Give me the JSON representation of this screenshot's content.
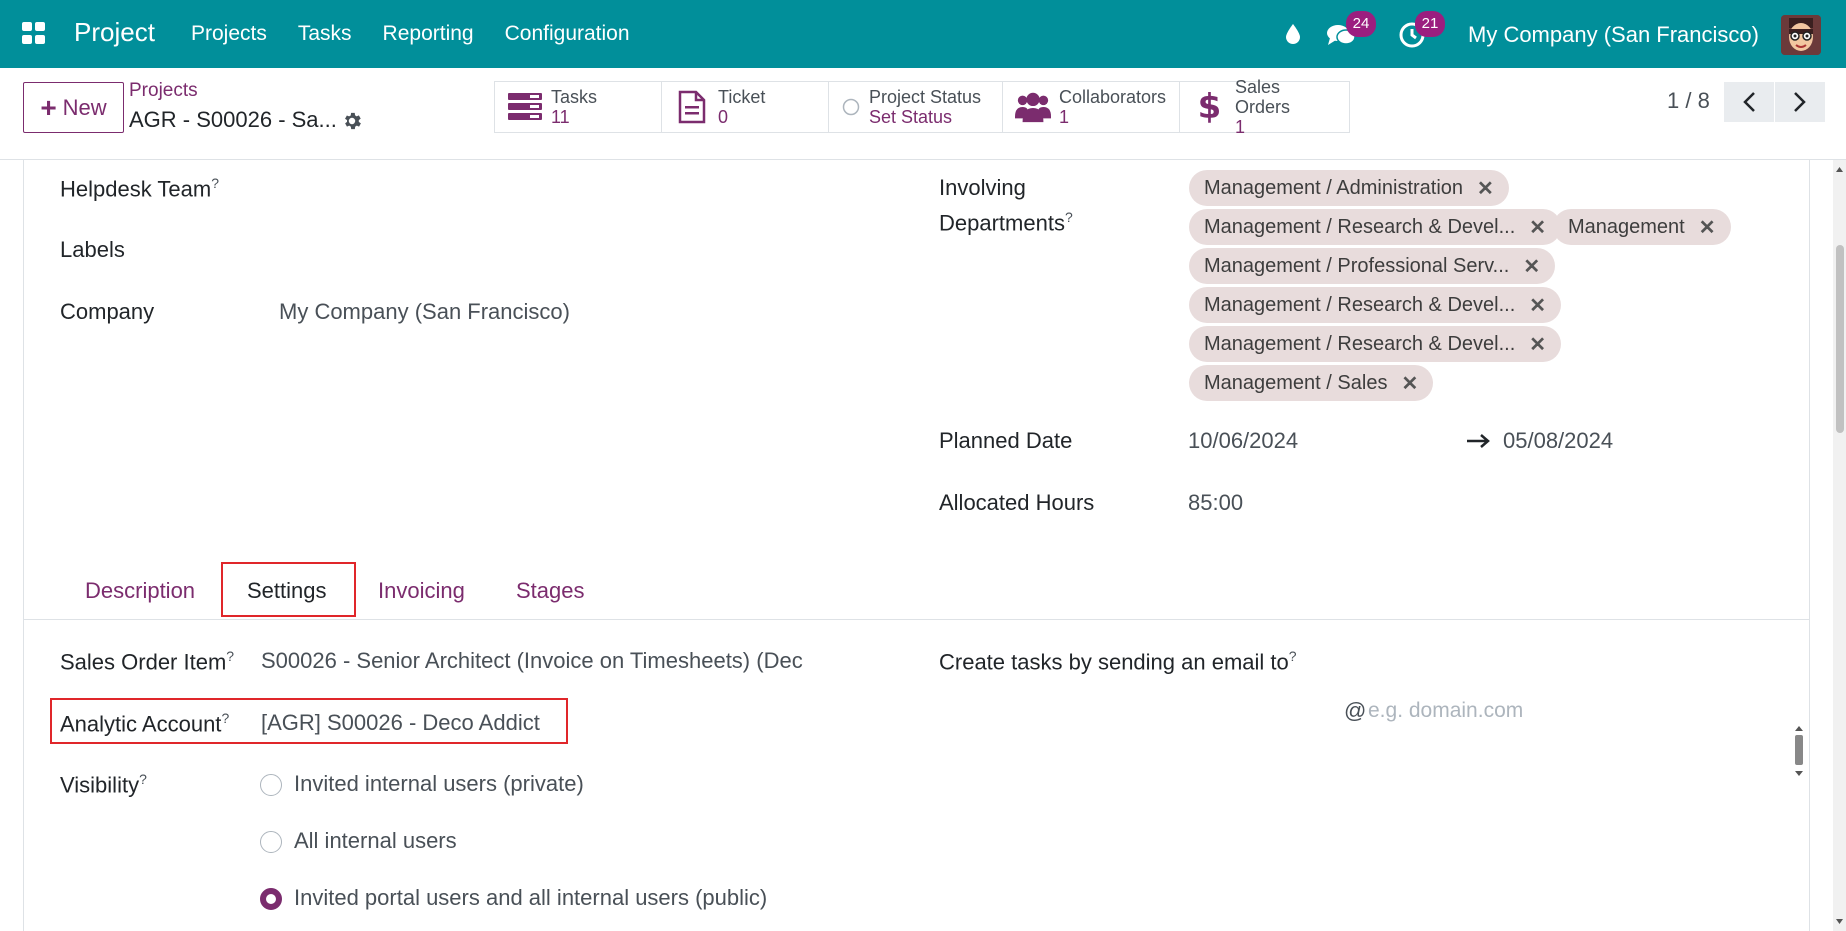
{
  "navbar": {
    "brand": "Project",
    "menu": [
      "Projects",
      "Tasks",
      "Reporting",
      "Configuration"
    ],
    "chat_count": "24",
    "activity_count": "21",
    "company": "My Company (San Francisco)",
    "bg_color": "#018f9a",
    "icons": [
      "apps-icon",
      "droplet-icon",
      "chat-icon",
      "clock-icon"
    ]
  },
  "control": {
    "new_label": "New",
    "breadcrumb_parent": "Projects",
    "breadcrumb_current": "AGR - S00026 - Sa...",
    "stats": [
      {
        "label": "Tasks",
        "value": "11",
        "icon": "tasks-icon"
      },
      {
        "label": "Ticket",
        "value": "0",
        "icon": "file-icon"
      },
      {
        "label": "Project Status",
        "value": "Set Status",
        "icon": "status-circle-icon"
      },
      {
        "label": "Collaborators",
        "value": "1",
        "icon": "users-icon"
      },
      {
        "label": "Sales Orders",
        "value": "1",
        "icon": "dollar-icon"
      }
    ],
    "pager": "1 / 8"
  },
  "form": {
    "helpdesk_team_label": "Helpdesk Team",
    "labels_label": "Labels",
    "company_label": "Company",
    "company_value": "My Company (San Francisco)",
    "involving_label_1": "Involving",
    "involving_label_2": "Departments",
    "departments": [
      "Management / Administration",
      "Management / Research & Devel...",
      "Management",
      "Management / Professional Serv...",
      "Management / Research & Devel...",
      "Management / Research & Devel...",
      "Management / Sales"
    ],
    "planned_date_label": "Planned Date",
    "planned_start": "10/06/2024",
    "planned_end": "05/08/2024",
    "allocated_hours_label": "Allocated Hours",
    "allocated_hours": "85:00",
    "help_mark": "?"
  },
  "tabs": [
    "Description",
    "Settings",
    "Invoicing",
    "Stages"
  ],
  "settings": {
    "sales_order_item_label": "Sales Order Item",
    "sales_order_item_value": "S00026 - Senior Architect (Invoice on Timesheets) (Dec",
    "analytic_account_label": "Analytic Account",
    "analytic_account_value": "[AGR] S00026 - Deco Addict",
    "email_label": "Create tasks by sending an email to",
    "email_at": "@",
    "email_placeholder": "e.g. domain.com",
    "visibility_label": "Visibility",
    "visibility_options": [
      "Invited internal users (private)",
      "All internal users",
      "Invited portal users and all internal users (public)"
    ],
    "visibility_selected": 2
  },
  "colors": {
    "primary": "#7b2c6e",
    "highlight": "#e0262a",
    "tag_bg": "#e8dcdc"
  }
}
